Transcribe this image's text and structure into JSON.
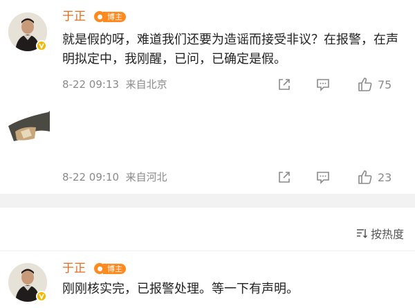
{
  "comments": [
    {
      "username": "于正",
      "badge": "博主",
      "text": "就是假的呀，难道我们还要为造谣而接受非议？在报警，在声明拟定中，我刚醒，已问，已确定是假。",
      "time": "8-22 09:13",
      "location": "来自北京",
      "likes": "75"
    },
    {
      "time": "8-22 09:10",
      "location": "来自河北",
      "likes": "23"
    },
    {
      "username": "于正",
      "badge": "博主",
      "text": "刚刚核实完，已报警处理。等一下有声明。"
    }
  ],
  "sort": {
    "label": "按热度"
  },
  "colors": {
    "username": "#e86b1c",
    "badge": "#ff8a1f",
    "meta": "#8a8a8a",
    "verified": "#f5b800"
  },
  "icons": {
    "share": "share-icon",
    "comment": "comment-icon",
    "like": "thumbs-up-icon",
    "sort": "sort-icon",
    "verified": "verified-v-icon"
  }
}
